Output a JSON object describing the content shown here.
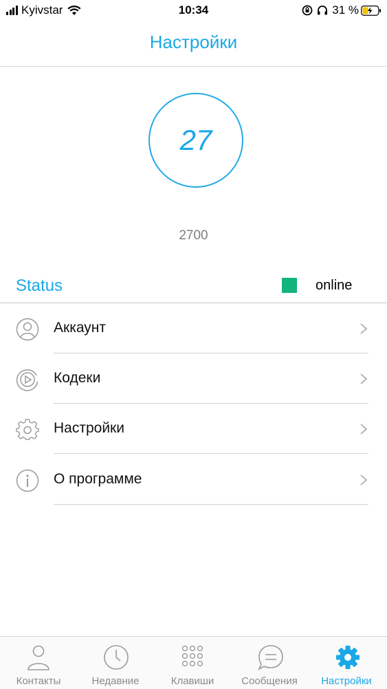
{
  "status_bar": {
    "carrier": "Kyivstar",
    "time": "10:34",
    "battery": "31 %"
  },
  "nav": {
    "title": "Настройки"
  },
  "account": {
    "extension": "27",
    "subtitle": "2700"
  },
  "status": {
    "label": "Status",
    "value": "online",
    "color": "#12b57d"
  },
  "menu": [
    {
      "label": "Аккаунт",
      "icon": "user-circle-icon"
    },
    {
      "label": "Кодеки",
      "icon": "play-circle-icon"
    },
    {
      "label": "Настройки",
      "icon": "gear-icon"
    },
    {
      "label": "О программе",
      "icon": "info-icon"
    }
  ],
  "tabs": [
    {
      "label": "Контакты",
      "icon": "person-icon"
    },
    {
      "label": "Недавние",
      "icon": "clock-icon"
    },
    {
      "label": "Клавиши",
      "icon": "keypad-icon"
    },
    {
      "label": "Сообщения",
      "icon": "chat-bubble-icon"
    },
    {
      "label": "Настройки",
      "icon": "gear-icon",
      "active": true
    }
  ],
  "colors": {
    "accent": "#1ba8e6",
    "online": "#12b57d"
  }
}
